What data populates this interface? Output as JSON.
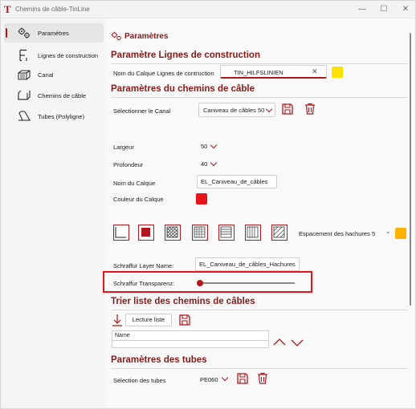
{
  "window": {
    "title": "Chemins de câble-TinLine",
    "minimize": "—",
    "maximize": "☐",
    "close": "✕"
  },
  "sidebar": {
    "items": [
      {
        "label": "Paramètres",
        "icon": "gears-icon",
        "active": true
      },
      {
        "label": "Lignes de construction",
        "icon": "construction-lines-icon",
        "active": false
      },
      {
        "label": "Canal",
        "icon": "canal-icon",
        "active": false
      },
      {
        "label": "Chemins de câble",
        "icon": "cable-tray-icon",
        "active": false
      },
      {
        "label": "Tubes (Polyligne)",
        "icon": "tubes-icon",
        "active": false
      }
    ]
  },
  "main": {
    "page_title": "Paramètres",
    "construction": {
      "section_title": "Paramètre Lignes de construction",
      "layer_label": "Nom du Calque Lignes de cоntruction",
      "layer_value": "TIN_HILFSLINIEN",
      "clear": "✕",
      "color": "#ffe100"
    },
    "cable_tray": {
      "section_title": "Paramètres du chemins de câble",
      "canal_label": "Sélectionner le Canal",
      "canal_value": "Caniveau de câbles 50",
      "width_label": "Largeur",
      "width_value": "50",
      "depth_label": "Profondeur",
      "depth_value": "40",
      "layer_label": "Nom du Calque",
      "layer_value": "EL_Caniveau_de_câbles",
      "layer_color_label": "Couleur du Calque",
      "layer_color": "#e8141b",
      "hatch_spacing_label": "Espacement des hachures",
      "hatch_spacing_value": "5",
      "hatch_color": "#ffb300",
      "hatch_layer_label": "Schraffur Layer Name:",
      "hatch_layer_value": "EL_Caniveau_de_câbles_Hachures",
      "transparency_label": "Schraffur Transparenz:",
      "transparency_value": 0
    },
    "sort": {
      "section_title": "Trier liste des chemins de câbles",
      "read_button": "Lecture liste",
      "column_header": "Name"
    },
    "tubes": {
      "section_title": "Paramètres des tubes",
      "select_label": "Sélection des tubes",
      "select_value": "PE060"
    }
  },
  "colors": {
    "accent": "#b3171d",
    "section_text": "#8a1a1a",
    "highlight": "#e8141b"
  }
}
